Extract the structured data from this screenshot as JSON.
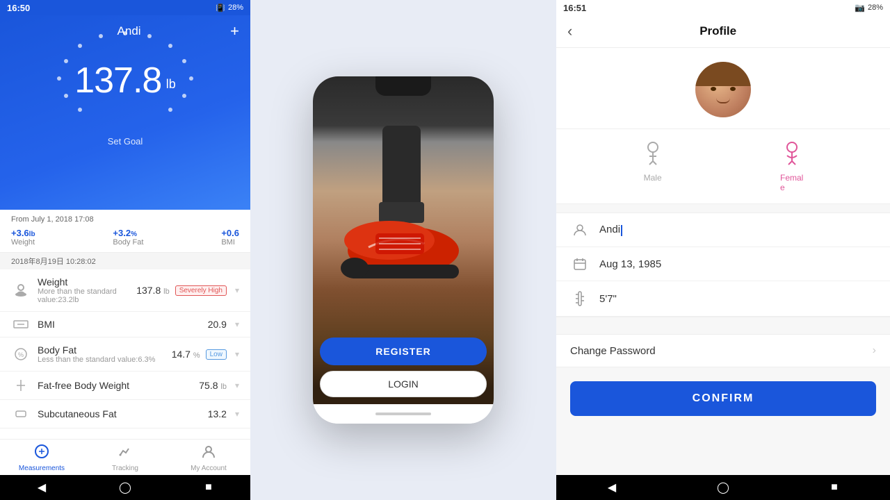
{
  "panel1": {
    "statusBar": {
      "time": "16:50",
      "batteryPct": "28%"
    },
    "header": {
      "userName": "Andi",
      "addIcon": "+"
    },
    "weightDisplay": {
      "value": "137.8",
      "unit": "lb"
    },
    "setGoal": "Set Goal",
    "statsFrom": {
      "label": "From July 1, 2018 17:08",
      "items": [
        {
          "value": "+3.6",
          "unit": "lb",
          "label": "Weight"
        },
        {
          "value": "+3.2",
          "unit": "%",
          "label": "Body Fat"
        },
        {
          "value": "+0.6",
          "unit": "",
          "label": "BMI"
        }
      ]
    },
    "timestamp": "2018年8月19日 10:28:02",
    "metrics": [
      {
        "name": "Weight",
        "value": "137.8",
        "unit": "lb",
        "sub": "More than the standard value:23.2lb",
        "badge": "Severely High",
        "badgeType": "high"
      },
      {
        "name": "BMI",
        "value": "20.9",
        "unit": "",
        "sub": "",
        "badge": "",
        "badgeType": ""
      },
      {
        "name": "Body Fat",
        "value": "14.7",
        "unit": "%",
        "sub": "Less than the standard value:6.3%",
        "badge": "Low",
        "badgeType": "low"
      },
      {
        "name": "Fat-free Body Weight",
        "value": "75.8",
        "unit": "lb",
        "sub": "",
        "badge": "",
        "badgeType": ""
      },
      {
        "name": "Subcutaneous Fat",
        "value": "13.2",
        "unit": "",
        "sub": "",
        "badge": "",
        "badgeType": ""
      }
    ],
    "bottomNav": [
      {
        "label": "Measurements",
        "active": true
      },
      {
        "label": "Tracking",
        "active": false
      },
      {
        "label": "My Account",
        "active": false
      }
    ]
  },
  "panel2": {
    "registerBtn": "REGISTER",
    "loginBtn": "LOGIN"
  },
  "panel3": {
    "statusBar": {
      "time": "16:51",
      "batteryPct": "28%"
    },
    "title": "Profile",
    "fields": {
      "name": "Andi",
      "birthday": "Aug 13, 1985",
      "height": "5'7\""
    },
    "gender": {
      "male": "Male",
      "female": "Female",
      "selected": "Female"
    },
    "changePassword": "Change Password",
    "confirmBtn": "CONFIRM"
  }
}
